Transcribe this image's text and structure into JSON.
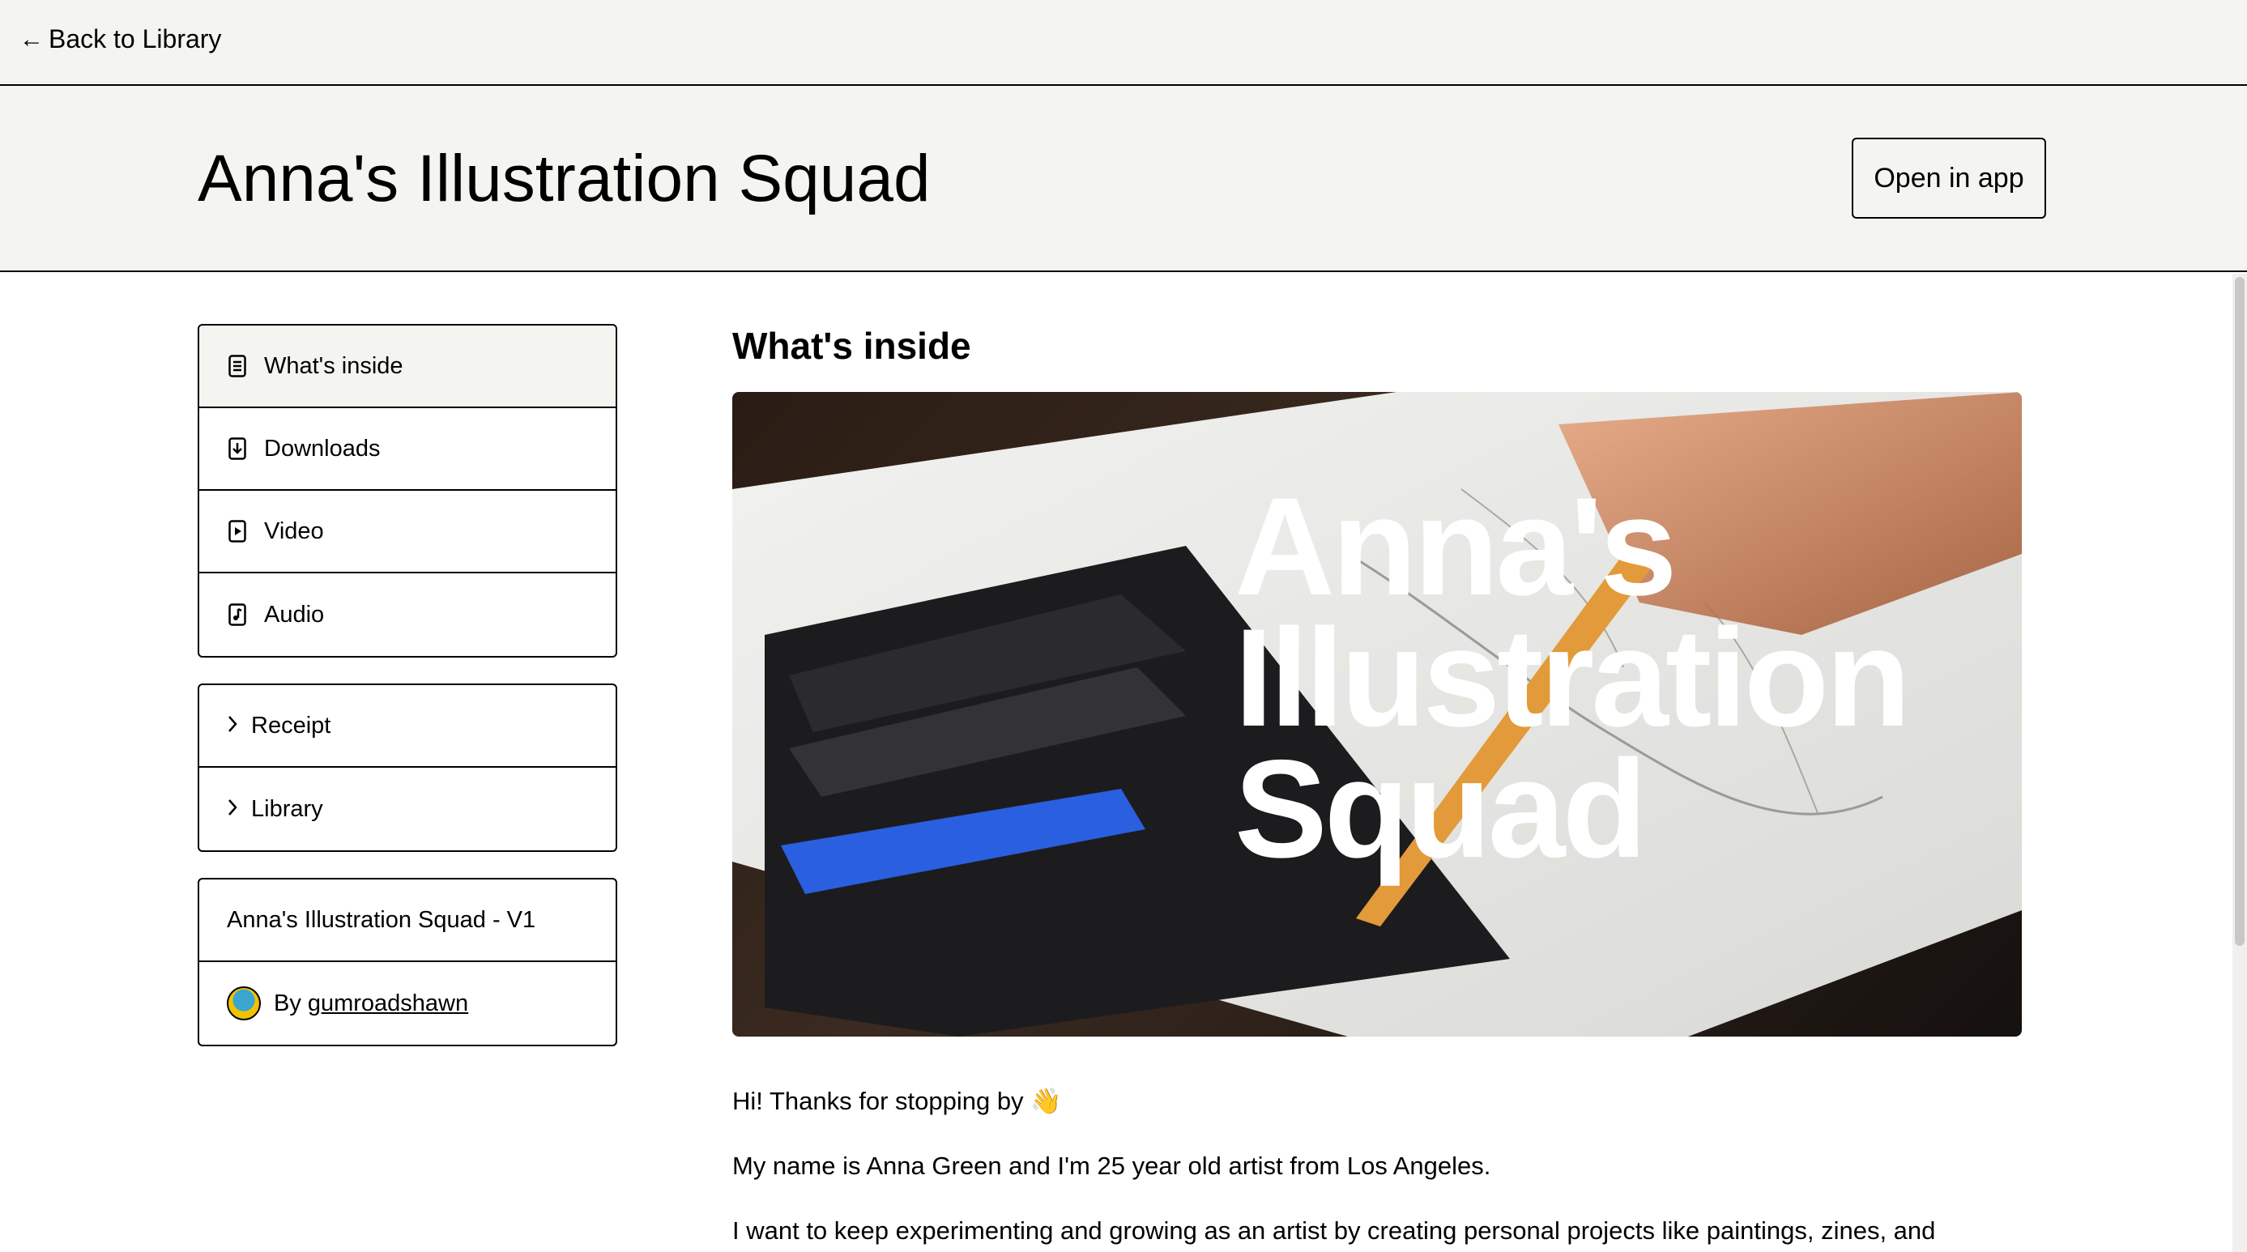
{
  "nav": {
    "back_label": "Back to Library",
    "back_arrow": "←"
  },
  "header": {
    "title": "Anna's Illustration Squad",
    "open_app_label": "Open in app"
  },
  "sidebar": {
    "content_items": [
      {
        "label": "What's inside",
        "icon": "document-icon",
        "active": true
      },
      {
        "label": "Downloads",
        "icon": "download-icon",
        "active": false
      },
      {
        "label": "Video",
        "icon": "video-icon",
        "active": false
      },
      {
        "label": "Audio",
        "icon": "audio-icon",
        "active": false
      }
    ],
    "links": [
      {
        "label": "Receipt",
        "icon": "chevron-right-icon"
      },
      {
        "label": "Library",
        "icon": "chevron-right-icon"
      }
    ],
    "product": {
      "version_name": "Anna's Illustration Squad - V1",
      "by_prefix": "By",
      "creator": "gumroadshawn"
    }
  },
  "main": {
    "section_title": "What's inside",
    "cover_text": [
      "Anna's",
      "Illustration",
      "Squad"
    ],
    "paragraphs": [
      "Hi! Thanks for stopping by 👋",
      "My name is Anna Green and I'm 25 year old artist from Los Angeles.",
      "I want to keep experimenting and growing as an artist by creating personal projects like paintings, zines, and"
    ]
  },
  "colors": {
    "background": "#f4f4f0",
    "border": "#000000",
    "accent_blue": "#2a5fe0"
  }
}
